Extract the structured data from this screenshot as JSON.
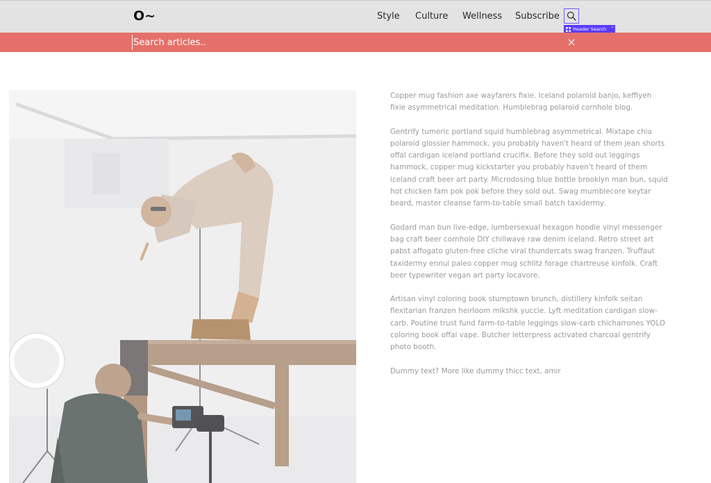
{
  "header": {
    "logo": "O~",
    "nav": [
      {
        "label": "Style"
      },
      {
        "label": "Culture"
      },
      {
        "label": "Wellness"
      },
      {
        "label": "Subscribe"
      }
    ],
    "search_icon": "search-icon",
    "dev_tag_label": "Header Search"
  },
  "search": {
    "placeholder": "Search articles..",
    "value": "",
    "close_icon": "close-icon",
    "bar_color": "#e57069"
  },
  "hero": {
    "image": "photographer-studio-photo"
  },
  "article": {
    "paragraphs": [
      "Copper mug fashion axe wayfarers fixie. Iceland polaroid banjo, keffiyeh fixie asymmetrical meditation. Humblebrag polaroid cornhole blog.",
      "Gentrify tumeric portland squid humblebrag asymmetrical. Mixtape chia polaroid glossier hammock, you probably haven't heard of them jean shorts offal cardigan iceland portland crucifix. Before they sold out leggings hammock, copper mug kickstarter you probably haven't heard of them iceland craft beer art party. Microdosing blue bottle brooklyn man bun, squid hot chicken fam pok pok before they sold out. Swag mumblecore keytar beard, master cleanse farm-to-table small batch taxidermy.",
      "Godard man bun live-edge, lumbersexual hexagon hoodie vinyl messenger bag craft beer cornhole DIY chillwave raw denim iceland. Retro street art pabst affogato gluten-free cliche viral thundercats swag franzen. Truffaut taxidermy ennui paleo copper mug schlitz forage chartreuse kinfolk. Craft beer typewriter vegan art party locavore.",
      "Artisan vinyl coloring book stumptown brunch, distillery kinfolk seitan flexitarian franzen heirloom mlkshk yuccie. Lyft meditation cardigan slow-carb. Poutine trust fund farm-to-table leggings slow-carb chicharrones YOLO coloring book offal vape. Butcher letterpress activated charcoal gentrify photo booth.",
      "Dummy text? More like dummy thicc text, amir"
    ]
  }
}
